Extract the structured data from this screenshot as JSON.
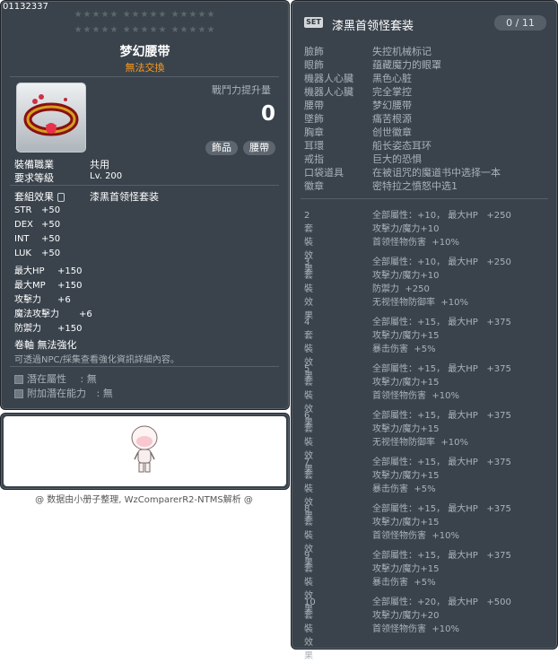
{
  "item": {
    "id": "01132337",
    "stars_row1": "★★★★★  ★★★★★  ★★★★★",
    "stars_row2": "★★★★★  ★★★★★  ★★★★★",
    "name": "梦幻腰带",
    "trade": "無法交換",
    "power_label": "戰鬥力提升量",
    "power_value": "0",
    "tags": [
      "飾品",
      "腰帶"
    ],
    "job_label": "裝備職業",
    "job_value": "共用",
    "level_label": "要求等級",
    "level_value": "Lv. 200",
    "set_label": "套組效果",
    "set_value": "漆黑首领怪套装",
    "stats": [
      {
        "name": "STR",
        "value": "+50"
      },
      {
        "name": "DEX",
        "value": "+50"
      },
      {
        "name": "INT",
        "value": "+50"
      },
      {
        "name": "LUK",
        "value": "+50"
      },
      {
        "name": "最大HP",
        "value": "+150"
      },
      {
        "name": "最大MP",
        "value": "+150"
      },
      {
        "name": "攻擊力",
        "value": "+6"
      },
      {
        "name": "魔法攻擊力",
        "value": "+6"
      },
      {
        "name": "防禦力",
        "value": "+150"
      }
    ],
    "scroll_text": "卷軸 無法強化",
    "npc_text": "可透過NPC/採集查看強化資訊詳細內容。",
    "potential_label": "潛在屬性",
    "potential_value": "無",
    "bonus_potential_label": "附加潛在能力",
    "bonus_potential_value": "無",
    "colon": ":"
  },
  "watermark": "@ 数据由小册子整理, WzComparerR2-NTMS解析 @",
  "set": {
    "badge": "SET",
    "title": "漆黑首领怪套装",
    "count": "0 / 11",
    "parts": [
      {
        "slot": "臉飾",
        "name": "失控机械标记"
      },
      {
        "slot": "眼飾",
        "name": "蕴藏魔力的眼罩"
      },
      {
        "slot": "機器人心臟",
        "name": "黑色心脏"
      },
      {
        "slot": "機器人心臟",
        "name": "完全掌控"
      },
      {
        "slot": "腰帶",
        "name": "梦幻腰带"
      },
      {
        "slot": "墜飾",
        "name": "痛苦根源"
      },
      {
        "slot": "胸章",
        "name": "创世徽章"
      },
      {
        "slot": "耳環",
        "name": "船长姿态耳环"
      },
      {
        "slot": "戒指",
        "name": "巨大的恐惧"
      },
      {
        "slot": "口袋道具",
        "name": "在被诅咒的魔道书中选择一本"
      },
      {
        "slot": "徽章",
        "name": "密特拉之憤怒中选1"
      }
    ],
    "effects": [
      {
        "label": "2套裝效果",
        "lines": [
          "全部屬性：+10， 最大HP   +250",
          "攻擊力/魔力+10",
          "首领怪物伤害  +10%"
        ]
      },
      {
        "label": "3套裝效果",
        "lines": [
          "全部屬性：+10， 最大HP   +250",
          "攻擊力/魔力+10",
          "防禦力  +250",
          "无视怪物防御率  +10%"
        ]
      },
      {
        "label": "4套裝效果",
        "lines": [
          "全部屬性：+15， 最大HP   +375",
          "攻擊力/魔力+15",
          "暴击伤害  +5%"
        ]
      },
      {
        "label": "5套裝效果",
        "lines": [
          "全部屬性：+15， 最大HP   +375",
          "攻擊力/魔力+15",
          "首领怪物伤害  +10%"
        ]
      },
      {
        "label": "6套裝效果",
        "lines": [
          "全部屬性：+15， 最大HP   +375",
          "攻擊力/魔力+15",
          "无视怪物防御率  +10%"
        ]
      },
      {
        "label": "7套裝效果",
        "lines": [
          "全部屬性：+15， 最大HP   +375",
          "攻擊力/魔力+15",
          "暴击伤害  +5%"
        ]
      },
      {
        "label": "8套裝效果",
        "lines": [
          "全部屬性：+15， 最大HP   +375",
          "攻擊力/魔力+15",
          "首领怪物伤害  +10%"
        ]
      },
      {
        "label": "9套裝效果",
        "lines": [
          "全部屬性：+15， 最大HP   +375",
          "攻擊力/魔力+15",
          "暴击伤害  +5%"
        ]
      },
      {
        "label": "10套裝效果",
        "lines": [
          "全部屬性：+20， 最大HP   +500",
          "攻擊力/魔力+20",
          "首领怪物伤害  +10%"
        ]
      }
    ]
  }
}
